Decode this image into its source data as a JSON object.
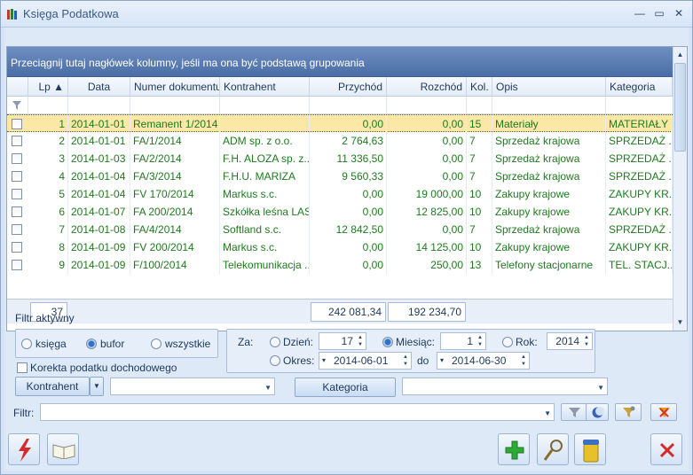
{
  "window": {
    "title": "Księga Podatkowa"
  },
  "grid": {
    "group_hint": "Przeciągnij tutaj nagłówek kolumny, jeśli ma ona być podstawą grupowania",
    "columns": {
      "lp": "Lp ▲",
      "data": "Data",
      "numer": "Numer dokumentu",
      "kontrahent": "Kontrahent",
      "przychod": "Przychód",
      "rozchod": "Rozchód",
      "kol": "Kol.",
      "opis": "Opis",
      "kategoria": "Kategoria"
    },
    "rows": [
      {
        "lp": "1",
        "data": "2014-01-01",
        "numer": "Remanent 1/2014",
        "kontrahent": "",
        "przychod": "0,00",
        "rozchod": "0,00",
        "kol": "15",
        "opis": "Materiały",
        "kategoria": "MATERIAŁY"
      },
      {
        "lp": "2",
        "data": "2014-01-01",
        "numer": "FA/1/2014",
        "kontrahent": "ADM sp. z o.o.",
        "przychod": "2 764,63",
        "rozchod": "0,00",
        "kol": "7",
        "opis": "Sprzedaż krajowa",
        "kategoria": "SPRZEDAŻ ..."
      },
      {
        "lp": "3",
        "data": "2014-01-03",
        "numer": "FA/2/2014",
        "kontrahent": "F.H. ALOZA sp. z...",
        "przychod": "11 336,50",
        "rozchod": "0,00",
        "kol": "7",
        "opis": "Sprzedaż krajowa",
        "kategoria": "SPRZEDAŻ ..."
      },
      {
        "lp": "4",
        "data": "2014-01-04",
        "numer": "FA/3/2014",
        "kontrahent": "F.H.U. MARIZA",
        "przychod": "9 560,33",
        "rozchod": "0,00",
        "kol": "7",
        "opis": "Sprzedaż krajowa",
        "kategoria": "SPRZEDAŻ ..."
      },
      {
        "lp": "5",
        "data": "2014-01-04",
        "numer": "FV 170/2014",
        "kontrahent": "Markus s.c.",
        "przychod": "0,00",
        "rozchod": "19 000,00",
        "kol": "10",
        "opis": "Zakupy krajowe",
        "kategoria": "ZAKUPY KR..."
      },
      {
        "lp": "6",
        "data": "2014-01-07",
        "numer": "FA 200/2014",
        "kontrahent": "Szkółka leśna LAS",
        "przychod": "0,00",
        "rozchod": "12 825,00",
        "kol": "10",
        "opis": "Zakupy krajowe",
        "kategoria": "ZAKUPY KR..."
      },
      {
        "lp": "7",
        "data": "2014-01-08",
        "numer": "FA/4/2014",
        "kontrahent": "Softland s.c.",
        "przychod": "12 842,50",
        "rozchod": "0,00",
        "kol": "7",
        "opis": "Sprzedaż krajowa",
        "kategoria": "SPRZEDAŻ ..."
      },
      {
        "lp": "8",
        "data": "2014-01-09",
        "numer": "FV 200/2014",
        "kontrahent": "Markus s.c.",
        "przychod": "0,00",
        "rozchod": "14 125,00",
        "kol": "10",
        "opis": "Zakupy krajowe",
        "kategoria": "ZAKUPY KR..."
      },
      {
        "lp": "9",
        "data": "2014-01-09",
        "numer": "F/100/2014",
        "kontrahent": "Telekomunikacja ...",
        "przychod": "0,00",
        "rozchod": "250,00",
        "kol": "13",
        "opis": "Telefony stacjonarne",
        "kategoria": "TEL. STACJ..."
      }
    ],
    "footer": {
      "count": "37",
      "przychod_sum": "242 081,34",
      "rozchod_sum": "192 234,70"
    }
  },
  "filters": {
    "section_label": "Filtr aktywny",
    "radio_ksiega": "księga",
    "radio_bufor": "bufor",
    "radio_wszystkie": "wszystkie",
    "korekta_label": "Korekta podatku dochodowego",
    "za_label": "Za:",
    "dzien_label": "Dzień:",
    "dzien_value": "17",
    "miesiac_label": "Miesiąc:",
    "miesiac_value": "1",
    "rok_label": "Rok:",
    "rok_value": "2014",
    "okres_label": "Okres:",
    "okres_from": "2014-06-01",
    "do_label": "do",
    "okres_to": "2014-06-30",
    "kontrahent_button": "Kontrahent",
    "kategoria_button": "Kategoria",
    "filtr_label": "Filtr:"
  }
}
